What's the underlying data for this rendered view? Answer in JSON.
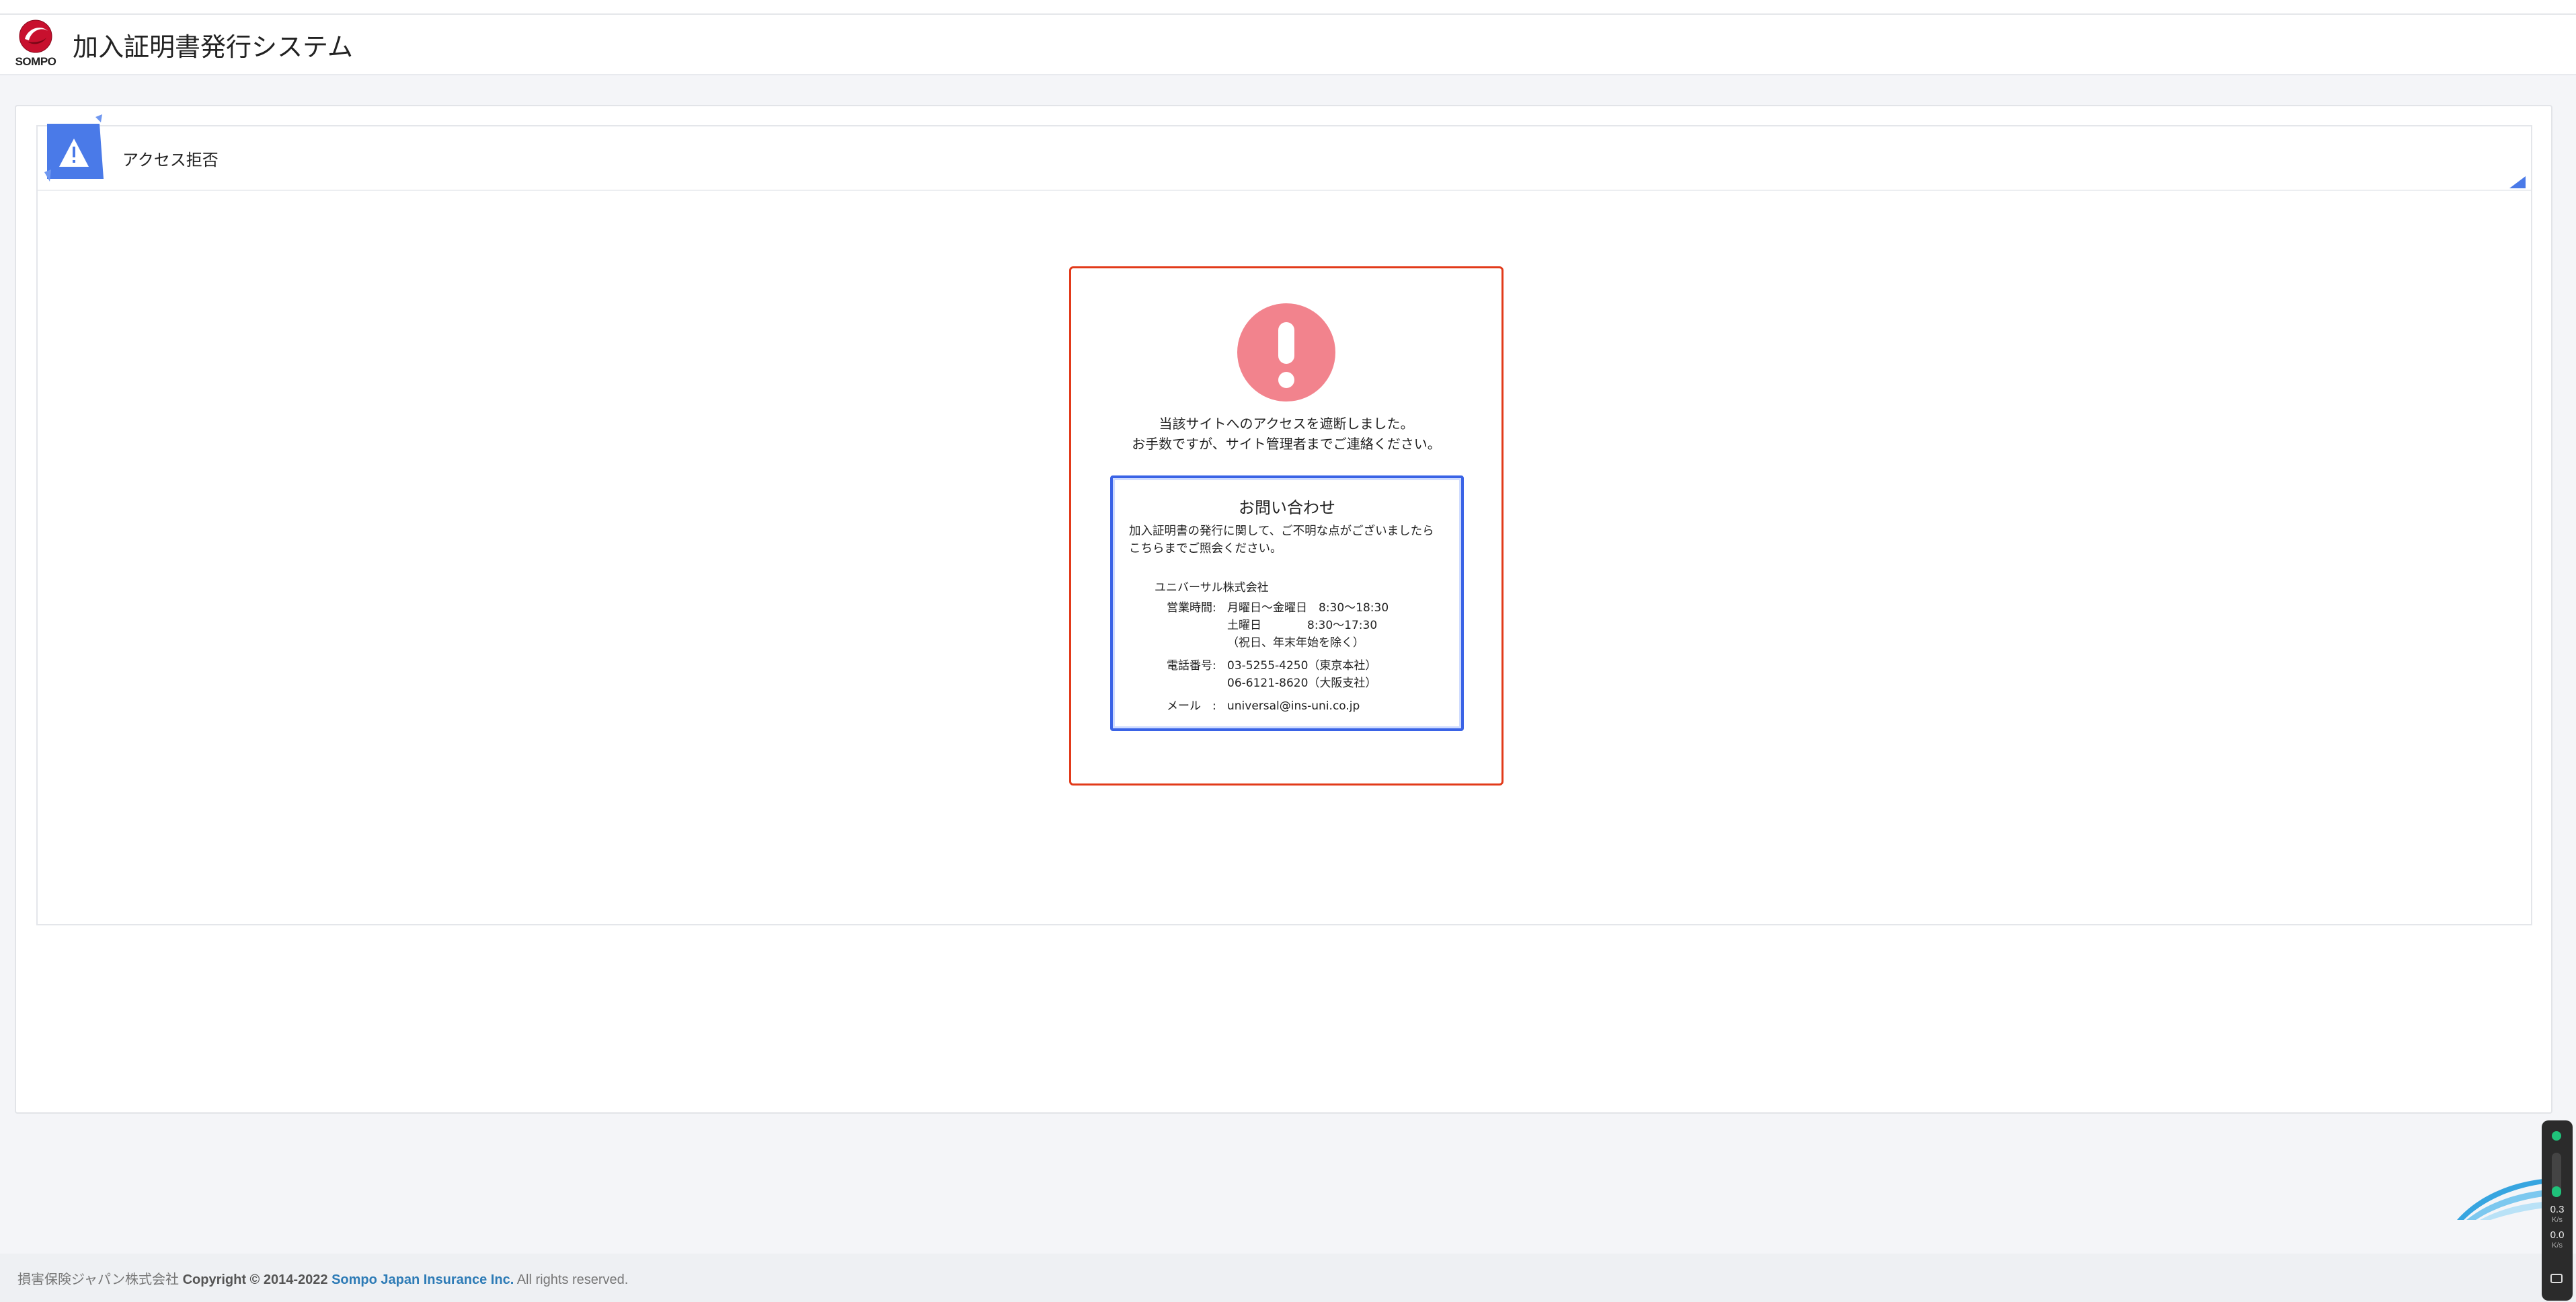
{
  "header": {
    "logo_text": "SOMPO",
    "title": "加入証明書発行システム"
  },
  "card": {
    "title": "アクセス拒否"
  },
  "error": {
    "line1": "当該サイトへのアクセスを遮断しました。",
    "line2": "お手数ですが、サイト管理者までご連絡ください。"
  },
  "contact": {
    "title": "お問い合わせ",
    "desc1": "加入証明書の発行に関して、ご不明な点がございましたら",
    "desc2": "こちらまでご照会ください。",
    "company": "ユニバーサル株式会社",
    "hours_label": "営業時間:",
    "hours_weekday": "月曜日〜金曜日　8:30〜18:30",
    "hours_saturday": "土曜日　　　　8:30〜17:30",
    "hours_note": "（祝日、年末年始を除く）",
    "phone_label": "電話番号:",
    "phone_tokyo": "03-5255-4250（東京本社）",
    "phone_osaka": "06-6121-8620（大阪支社）",
    "mail_label": "メール　:",
    "mail": "universal@ins-uni.co.jp"
  },
  "footer": {
    "company": "損害保険ジャパン株式会社",
    "copyright": "Copyright © 2014-2022",
    "brand": "Sompo Japan Insurance Inc.",
    "rights": "All rights reserved."
  },
  "widget": {
    "up_value": "0.3",
    "up_unit": "K/s",
    "down_value": "0.0",
    "down_unit": "K/s"
  },
  "colors": {
    "error_border": "#e23a1a",
    "alert_circle": "#f2838d",
    "contact_border": "#3a63e6",
    "brand_link": "#2d7bb6"
  }
}
